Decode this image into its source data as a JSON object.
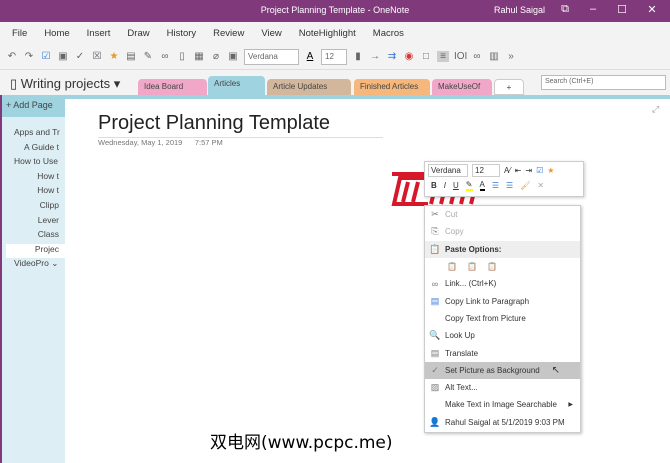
{
  "window": {
    "title": "Project Planning Template  -  OneNote",
    "user": "Rahul Saigal"
  },
  "menu": [
    "File",
    "Home",
    "Insert",
    "Draw",
    "History",
    "Review",
    "View",
    "NoteHighlight",
    "Macros"
  ],
  "toolbar": {
    "font": "Verdana",
    "size": "12"
  },
  "notebook": {
    "name": "Writing projects",
    "search_placeholder": "Search (Ctrl+E)",
    "tabs": [
      {
        "label": "Idea Board",
        "color": "#f1a8c8"
      },
      {
        "label": "Articles",
        "color": "#9fd3df"
      },
      {
        "label": "Article Updates",
        "color": "#d2b79c"
      },
      {
        "label": "Finished Articles",
        "color": "#f5b77b"
      },
      {
        "label": "MakeUseOf",
        "color": "#f1a8c8"
      },
      {
        "label": "+",
        "color": "#ffffff"
      }
    ]
  },
  "sidebar": {
    "add_page": "Add Page",
    "pages": [
      "Apps and Tr",
      "A Guide t",
      "How to Use",
      "How t",
      "How t",
      "Clipp",
      "Lever",
      "Class",
      "Projec",
      "VideoPro"
    ]
  },
  "page": {
    "title": "Project Planning Template",
    "date": "Wednesday, May 1, 2019",
    "time": "7:57 PM"
  },
  "mini_toolbar": {
    "font": "Verdana",
    "size": "12"
  },
  "context_menu": {
    "items": [
      "Cut",
      "Copy",
      "Paste Options:",
      "",
      "Link...  (Ctrl+K)",
      "Copy Link to Paragraph",
      "Copy Text from Picture",
      "Look Up",
      "Translate",
      "Set Picture as Background",
      "Alt Text...",
      "Make Text in Image Searchable",
      "Rahul Saigal at 5/1/2019 9:03 PM"
    ]
  },
  "watermark": "双电网(www.pcpc.me)"
}
